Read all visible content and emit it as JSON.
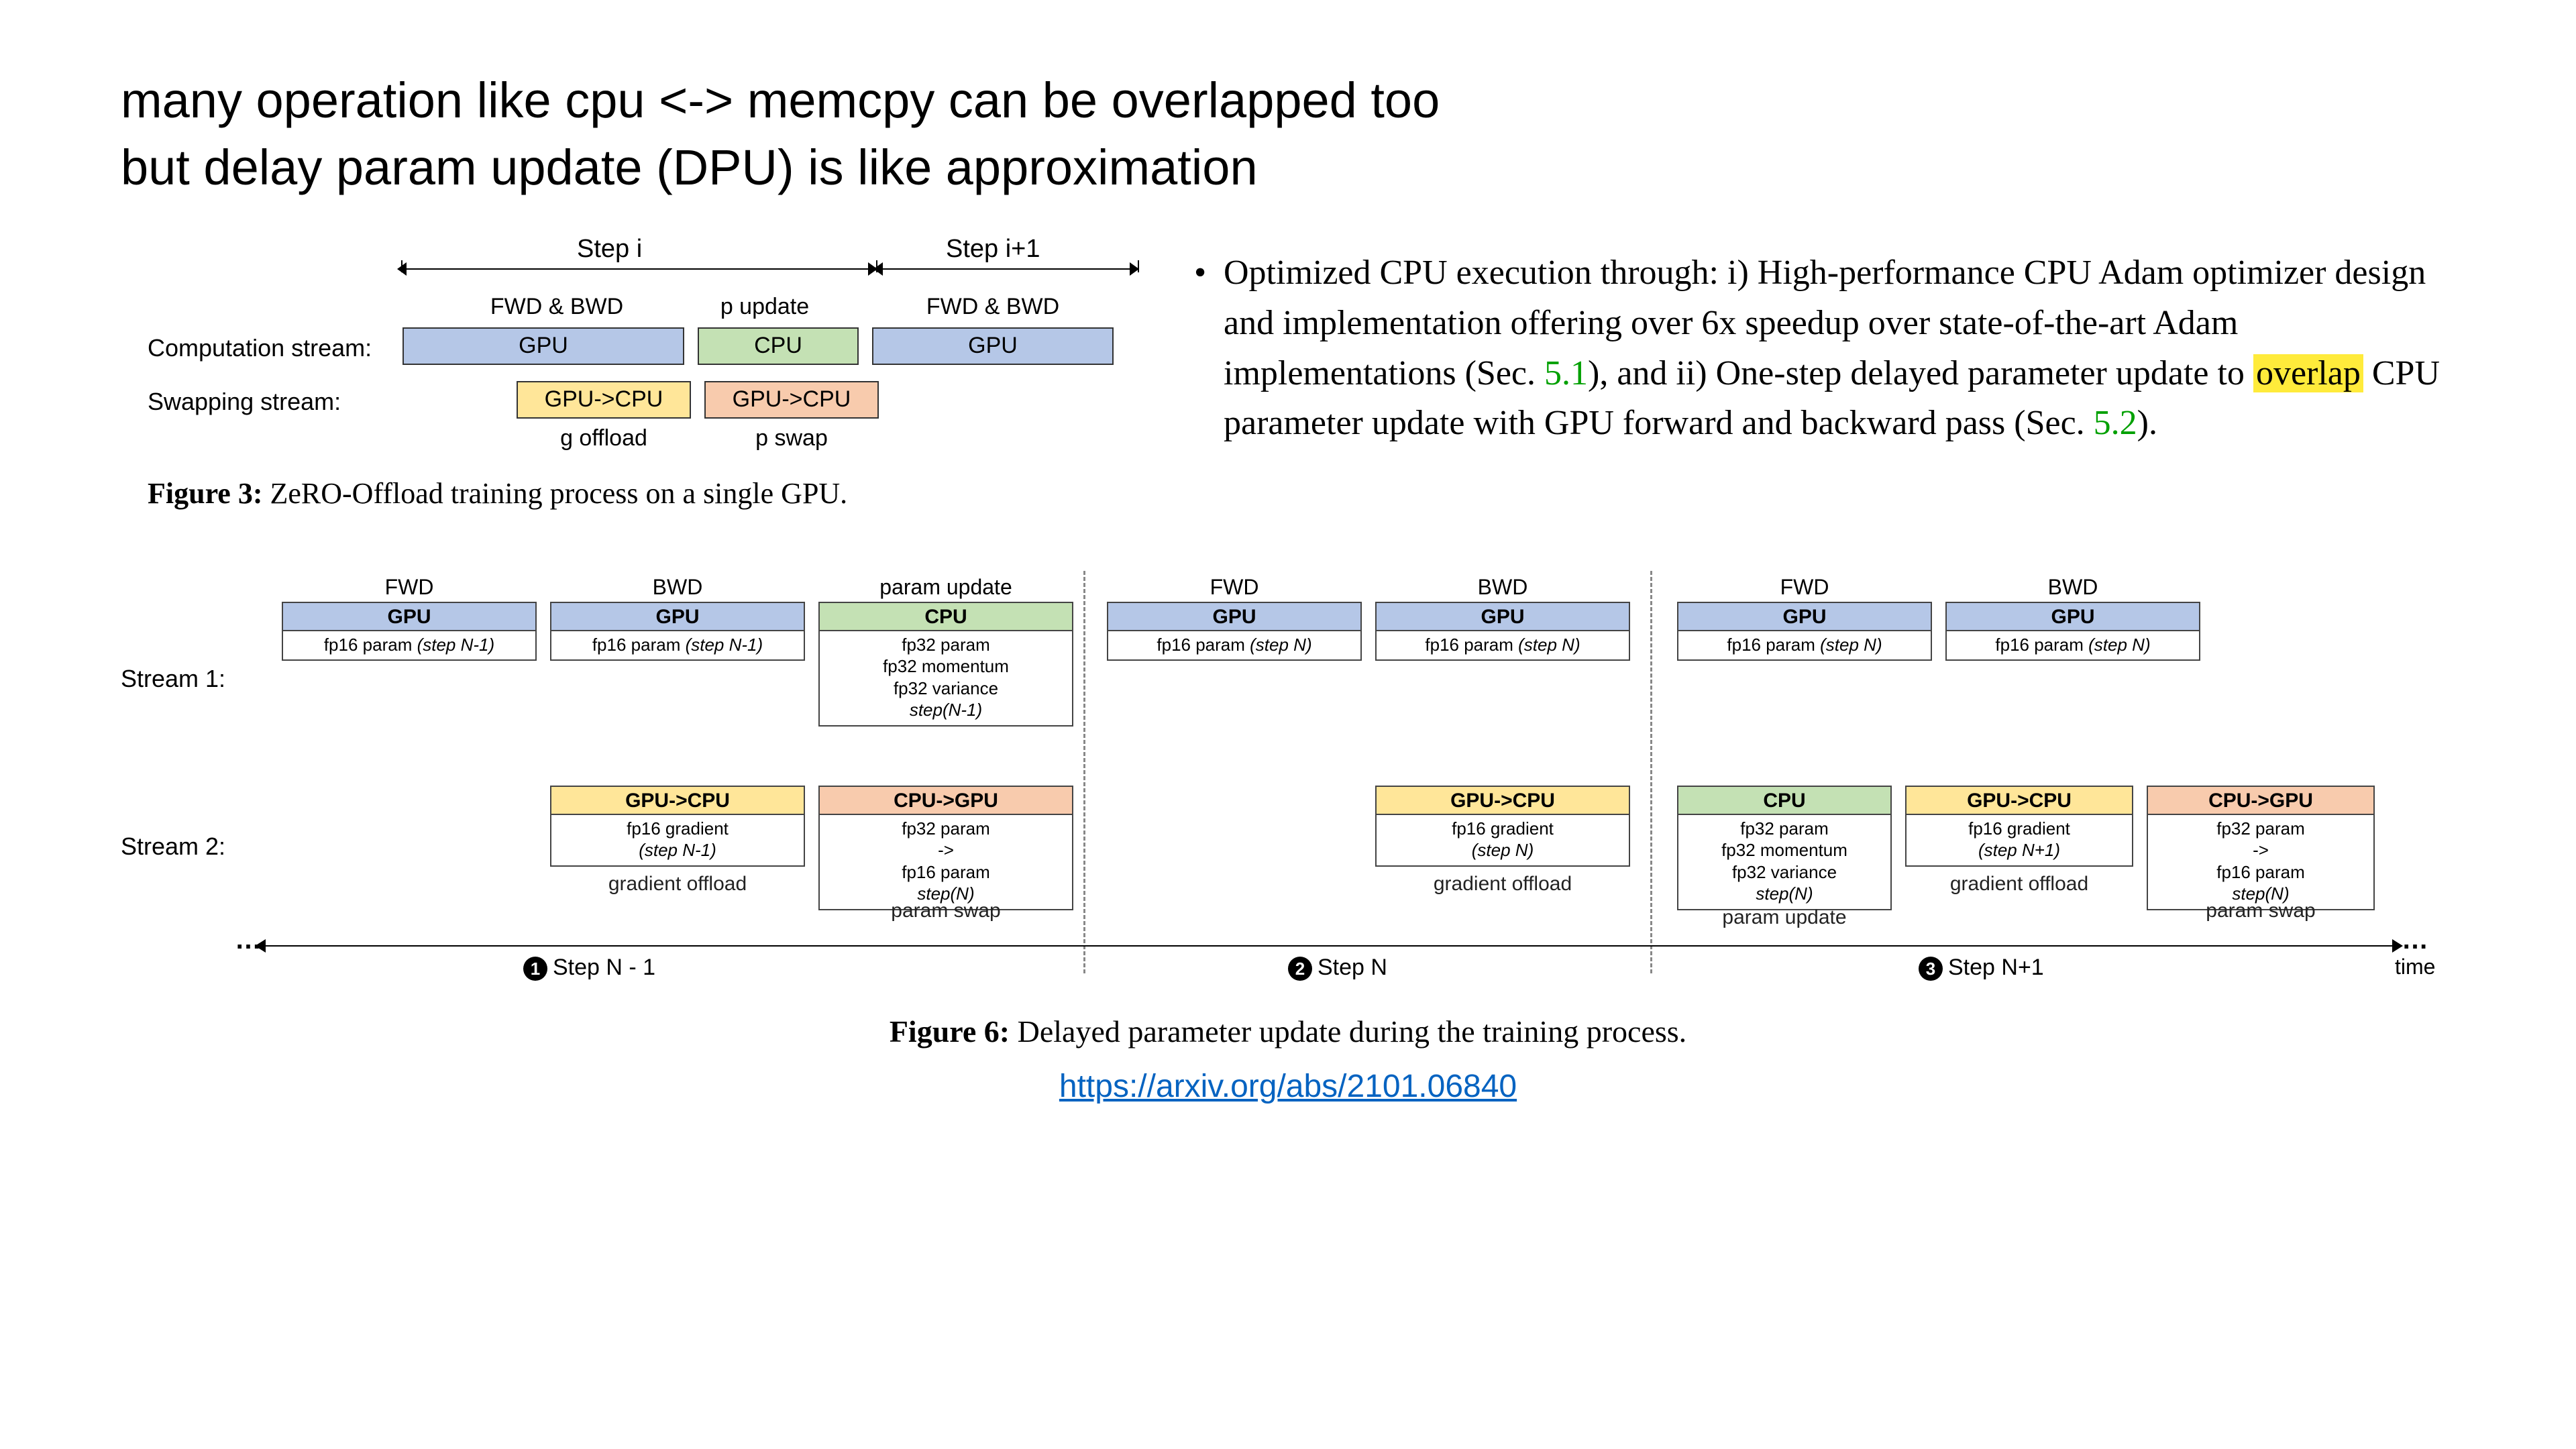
{
  "title_line1": "many operation like cpu <-> memcpy can be overlapped too",
  "title_line2": "but delay param update (DPU) is like approximation",
  "bullet": {
    "pre": "Optimized CPU execution through: i) High-performance CPU Adam optimizer design and implementation offering over 6x speedup over state-of-the-art Adam implementations (Sec. ",
    "sec1": "5.1",
    "mid": "), and ii) One-step delayed parameter update to ",
    "hl": "overlap",
    "post1": " CPU parameter update with GPU forward and backward pass (Sec. ",
    "sec2": "5.2",
    "post2": ")."
  },
  "fig3": {
    "step_i": "Step i",
    "step_i1": "Step i+1",
    "fwd_bwd": "FWD & BWD",
    "p_update": "p update",
    "computation_stream": "Computation stream:",
    "swapping_stream": "Swapping stream:",
    "gpu": "GPU",
    "cpu": "CPU",
    "gpu_to_cpu": "GPU->CPU",
    "g_offload": "g offload",
    "p_swap": "p swap",
    "caption_b": "Figure 3:",
    "caption": " ZeRO-Offload training process on a single GPU."
  },
  "fig6": {
    "stream1": "Stream 1:",
    "stream2": "Stream 2:",
    "fwd": "FWD",
    "bwd": "BWD",
    "param_update": "param update",
    "gpu": "GPU",
    "cpu": "CPU",
    "gpu_to_cpu": "GPU->CPU",
    "cpu_to_gpu": "CPU->GPU",
    "fp16_param_nm1": "fp16 param (step N-1)",
    "fp16_param_n": "fp16 param (step N)",
    "cpu_body": "fp32 param\nfp32 momentum\nfp32 variance",
    "cpu_step_nm1": "step(N-1)",
    "cpu_step_n": "step(N)",
    "fp16_grad_nm1": "fp16 gradient\n(step N-1)",
    "fp16_grad_n": "fp16 gradient\n(step N)",
    "fp16_grad_np1": "fp16 gradient\n(step N+1)",
    "gradient_offload": "gradient offload",
    "param_swap": "param swap",
    "cpugpu_body_n": "fp32 param\n->\nfp16 param\nstep(N)",
    "step_nm1": "Step N - 1",
    "step_n": "Step N",
    "step_np1": "Step N+1",
    "time": "time",
    "dots": "…",
    "caption_b": "Figure 6:",
    "caption": " Delayed parameter update during the training process."
  },
  "link": "https://arxiv.org/abs/2101.06840"
}
